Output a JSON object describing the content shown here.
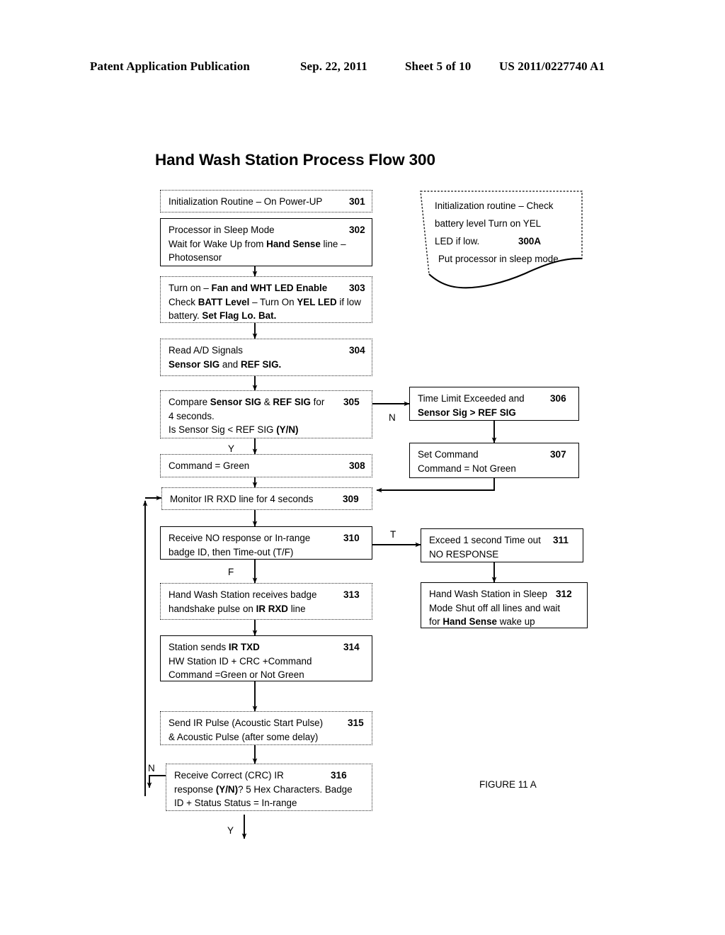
{
  "header": {
    "publication": "Patent Application Publication",
    "date": "Sep. 22, 2011",
    "sheet": "Sheet 5 of 10",
    "patent_number": "US 2011/0227740 A1"
  },
  "title": "Hand Wash Station Process Flow   300",
  "figure_caption": "FIGURE 11 A",
  "note": {
    "id": "300A",
    "line1": "Initialization routine – Check",
    "line2": "battery level Turn on YEL",
    "line3": "LED if low.",
    "line4": "Put processor in sleep mode"
  },
  "boxes": [
    {
      "id": "301",
      "name": "box-301-initialization-routine",
      "lines": [
        [
          {
            "t": "Initialization Routine – On Power-UP",
            "b": false
          }
        ]
      ]
    },
    {
      "id": "302",
      "name": "box-302-processor-sleep-mode",
      "lines": [
        [
          {
            "t": "Processor in Sleep Mode",
            "b": false
          }
        ],
        [
          {
            "t": "Wait for Wake Up from ",
            "b": false
          },
          {
            "t": "Hand Sense",
            "b": true
          },
          {
            "t": " line –",
            "b": false
          }
        ],
        [
          {
            "t": "Photosensor",
            "b": false
          }
        ]
      ]
    },
    {
      "id": "303",
      "name": "box-303-turn-on-fan-led",
      "lines": [
        [
          {
            "t": "Turn on – ",
            "b": false
          },
          {
            "t": "Fan and WHT LED Enable",
            "b": true
          }
        ],
        [
          {
            "t": "Check ",
            "b": false
          },
          {
            "t": "BATT Level",
            "b": true
          },
          {
            "t": " – Turn On ",
            "b": false
          },
          {
            "t": "YEL LED",
            "b": true
          },
          {
            "t": " if low",
            "b": false
          }
        ],
        [
          {
            "t": "battery.  ",
            "b": false
          },
          {
            "t": "Set Flag Lo. Bat.",
            "b": true
          }
        ]
      ]
    },
    {
      "id": "304",
      "name": "box-304-read-ad-signals",
      "lines": [
        [
          {
            "t": "Read A/D Signals",
            "b": false
          }
        ],
        [
          {
            "t": "Sensor SIG",
            "b": true
          },
          {
            "t": " and ",
            "b": false
          },
          {
            "t": "REF SIG.",
            "b": true
          }
        ]
      ]
    },
    {
      "id": "305",
      "name": "box-305-compare-sensor-ref",
      "lines": [
        [
          {
            "t": "Compare ",
            "b": false
          },
          {
            "t": "Sensor SIG",
            "b": true
          },
          {
            "t": " & ",
            "b": false
          },
          {
            "t": "REF SIG",
            "b": true
          },
          {
            "t": " for",
            "b": false
          }
        ],
        [
          {
            "t": "4 seconds.",
            "b": false
          }
        ],
        [
          {
            "t": " Is Sensor Sig < REF SIG ",
            "b": false
          },
          {
            "t": "(Y/N)",
            "b": true
          }
        ]
      ]
    },
    {
      "id": "306",
      "name": "box-306-time-limit-exceeded",
      "lines": [
        [
          {
            "t": "Time Limit Exceeded and",
            "b": false
          }
        ],
        [
          {
            "t": "Sensor Sig  > REF SIG",
            "b": true
          }
        ]
      ]
    },
    {
      "id": "307",
      "name": "box-307-set-command-not-green",
      "lines": [
        [
          {
            "t": "Set Command",
            "b": false
          }
        ],
        [
          {
            "t": "Command = Not Green",
            "b": false
          }
        ]
      ]
    },
    {
      "id": "308",
      "name": "box-308-command-green",
      "lines": [
        [
          {
            "t": "Command = Green",
            "b": false
          }
        ]
      ]
    },
    {
      "id": "309",
      "name": "box-309-monitor-ir-rxd",
      "lines": [
        [
          {
            "t": "Monitor IR RXD line for 4 seconds",
            "b": false
          }
        ]
      ]
    },
    {
      "id": "310",
      "name": "box-310-receive-no-response",
      "lines": [
        [
          {
            "t": "Receive NO response or In-range",
            "b": false
          }
        ],
        [
          {
            "t": "badge ID, then Time-out (T/F)",
            "b": false
          }
        ]
      ]
    },
    {
      "id": "311",
      "name": "box-311-exceed-timeout",
      "lines": [
        [
          {
            "t": "Exceed 1 second Time out",
            "b": false
          }
        ],
        [
          {
            "t": "NO RESPONSE",
            "b": false
          }
        ]
      ]
    },
    {
      "id": "312",
      "name": "box-312-station-sleep-mode",
      "lines": [
        [
          {
            "t": "Hand Wash Station in Sleep",
            "b": false
          }
        ],
        [
          {
            "t": "Mode Shut off all lines and wait",
            "b": false
          }
        ],
        [
          {
            "t": "for ",
            "b": false
          },
          {
            "t": "Hand Sense",
            "b": true
          },
          {
            "t": " wake up",
            "b": false
          }
        ]
      ]
    },
    {
      "id": "313",
      "name": "box-313-receives-badge-handshake",
      "lines": [
        [
          {
            "t": "Hand Wash Station receives  badge",
            "b": false
          }
        ],
        [
          {
            "t": "handshake pulse on ",
            "b": false
          },
          {
            "t": "IR RXD",
            "b": true
          },
          {
            "t": " line",
            "b": false
          }
        ]
      ]
    },
    {
      "id": "314",
      "name": "box-314-station-sends-ir-txd",
      "lines": [
        [
          {
            "t": "Station sends ",
            "b": false
          },
          {
            "t": "IR TXD",
            "b": true
          }
        ],
        [
          {
            "t": " HW Station ID + CRC +Command",
            "b": false
          }
        ],
        [
          {
            "t": "Command =Green or Not Green",
            "b": false
          }
        ]
      ]
    },
    {
      "id": "315",
      "name": "box-315-send-ir-pulse",
      "lines": [
        [
          {
            "t": "Send IR Pulse (Acoustic Start Pulse)",
            "b": false
          }
        ],
        [
          {
            "t": "&  Acoustic Pulse (after some delay)",
            "b": false
          }
        ]
      ]
    },
    {
      "id": "316",
      "name": "box-316-receive-correct-crc",
      "lines": [
        [
          {
            "t": "Receive Correct (CRC) IR",
            "b": false
          }
        ],
        [
          {
            "t": "response ",
            "b": false
          },
          {
            "t": "(Y/N)",
            "b": true
          },
          {
            "t": "?  5 Hex Characters.  Badge",
            "b": false
          }
        ],
        [
          {
            "t": "ID + Status Status = In-range",
            "b": false
          }
        ]
      ]
    }
  ],
  "edge_labels": {
    "n_305_306": "N",
    "y_305_308": "Y",
    "t_310_311": "T",
    "f_310_313": "F",
    "n_316_loop": "N",
    "y_316_out": "Y"
  }
}
